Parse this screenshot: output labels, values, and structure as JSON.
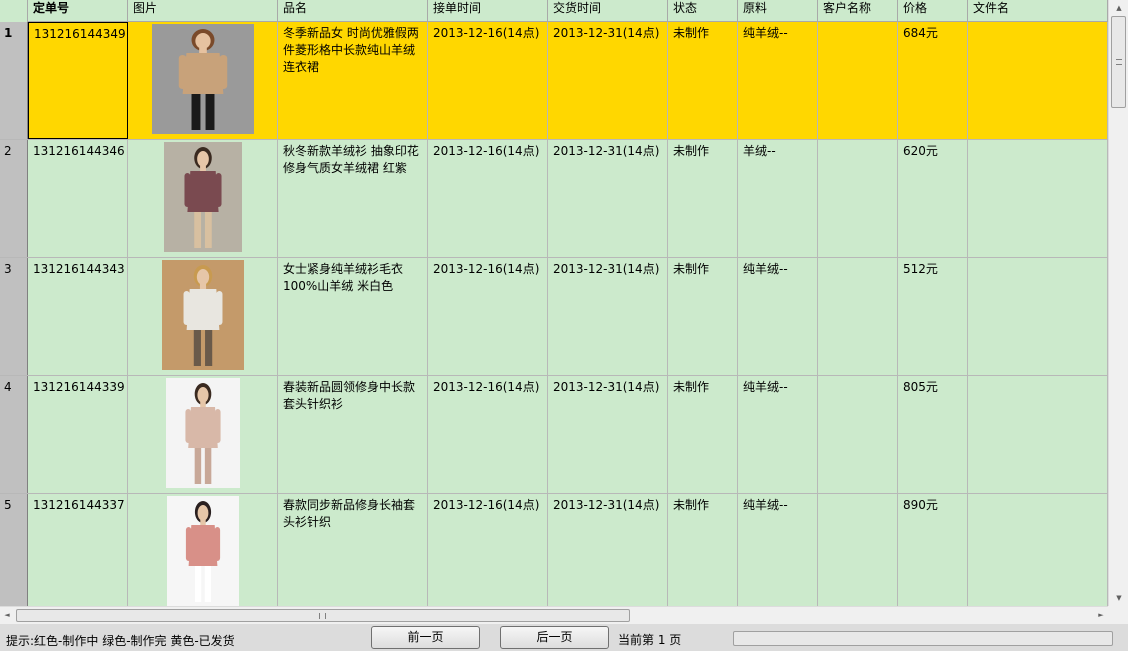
{
  "columns": [
    {
      "label": "",
      "width": 28
    },
    {
      "label": "定单号",
      "width": 100,
      "bold": true
    },
    {
      "label": "图片",
      "width": 150
    },
    {
      "label": "品名",
      "width": 150
    },
    {
      "label": "接单时间",
      "width": 120
    },
    {
      "label": "交货时间",
      "width": 120
    },
    {
      "label": "状态",
      "width": 70
    },
    {
      "label": "原料",
      "width": 80
    },
    {
      "label": "客户名称",
      "width": 80
    },
    {
      "label": "价格",
      "width": 70
    },
    {
      "label": "文件名",
      "width": 140
    }
  ],
  "rows": [
    {
      "num": "1",
      "order_id": "131216144349",
      "image": "model-beige-dress",
      "name": "冬季新品女 时尚优雅假两件菱形格中长款纯山羊绒连衣裙",
      "order_time": "2013-12-16(14点)",
      "delivery_time": "2013-12-31(14点)",
      "status": "未制作",
      "material": "纯羊绒--",
      "customer": "",
      "price": "684元",
      "filename": "",
      "selected": true
    },
    {
      "num": "2",
      "order_id": "131216144346",
      "image": "model-print-sweater",
      "name": "秋冬新款羊绒衫 抽象印花修身气质女羊绒裙 红紫",
      "order_time": "2013-12-16(14点)",
      "delivery_time": "2013-12-31(14点)",
      "status": "未制作",
      "material": "羊绒--",
      "customer": "",
      "price": "620元",
      "filename": "",
      "selected": false
    },
    {
      "num": "3",
      "order_id": "131216144343",
      "image": "model-white-sweater",
      "name": "女士紧身纯羊绒衫毛衣 100%山羊绒 米白色",
      "order_time": "2013-12-16(14点)",
      "delivery_time": "2013-12-31(14点)",
      "status": "未制作",
      "material": "纯羊绒--",
      "customer": "",
      "price": "512元",
      "filename": "",
      "selected": false
    },
    {
      "num": "4",
      "order_id": "131216144339",
      "image": "model-long-knit",
      "name": "春装新品圆领修身中长款套头针织衫",
      "order_time": "2013-12-16(14点)",
      "delivery_time": "2013-12-31(14点)",
      "status": "未制作",
      "material": "纯羊绒--",
      "customer": "",
      "price": "805元",
      "filename": "",
      "selected": false
    },
    {
      "num": "5",
      "order_id": "131216144337",
      "image": "model-pink-knit",
      "name": "春款同步新品修身长袖套头衫针织",
      "order_time": "2013-12-16(14点)",
      "delivery_time": "2013-12-31(14点)",
      "status": "未制作",
      "material": "纯羊绒--",
      "customer": "",
      "price": "890元",
      "filename": "",
      "selected": false
    }
  ],
  "thumbs": {
    "model-beige-dress": {
      "bg": "#9a9a9a",
      "garment": "#c8a27a",
      "skin": "#e6c2a0",
      "hair": "#7a4a2a",
      "legs": "#1a1a1a"
    },
    "model-print-sweater": {
      "bg": "#b7b1a4",
      "garment": "#7a4a50",
      "skin": "#e6c6a8",
      "hair": "#3a2a20",
      "legs": "#d8c0a0"
    },
    "model-white-sweater": {
      "bg": "#c49a6a",
      "garment": "#e8e6e0",
      "skin": "#e6c6a8",
      "hair": "#c89a50",
      "legs": "#6a5a4a"
    },
    "model-long-knit": {
      "bg": "#f4f4f4",
      "garment": "#d8b8a8",
      "skin": "#e6c6a8",
      "hair": "#3a2a20",
      "legs": "#c8a898"
    },
    "model-pink-knit": {
      "bg": "#f6f6f6",
      "garment": "#d89088",
      "skin": "#e6c6a8",
      "hair": "#2a2020",
      "legs": "#ffffff"
    }
  },
  "statusbar": {
    "hint": "提示:红色-制作中  绿色-制作完  黄色-已发货",
    "prev_label": "前一页",
    "next_label": "后一页",
    "page_info": "当前第 1 页"
  },
  "colors": {
    "grid_bg": "#cceacc",
    "selected_row": "#ffd700",
    "row_header": "#c0c0c0"
  },
  "icons": {
    "v_up": "▲",
    "v_down": "▼",
    "h_left": "◄",
    "h_right": "►"
  }
}
